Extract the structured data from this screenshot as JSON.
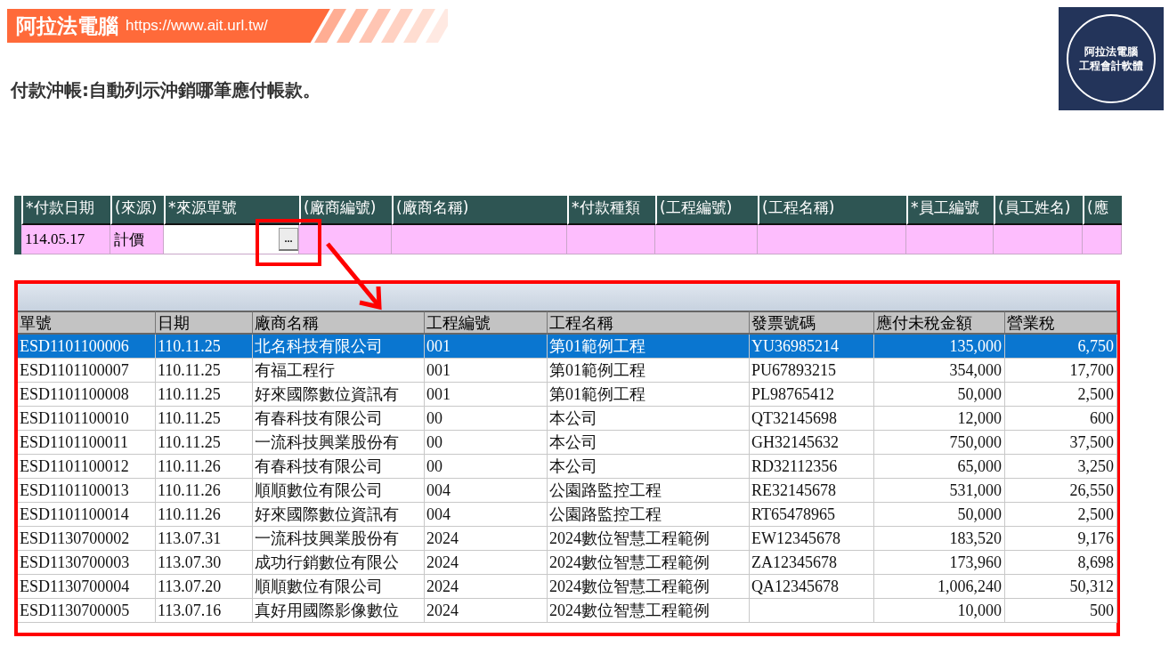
{
  "banner": {
    "brand": "阿拉法電腦",
    "url": "https://www.ait.url.tw/"
  },
  "subtitle": "付款沖帳:自動列示沖銷哪筆應付帳款。",
  "logo": {
    "lines": [
      "阿拉法電腦",
      "工程會計軟體"
    ]
  },
  "form": {
    "columns": [
      "*付款日期",
      "(來源)",
      "*來源單號",
      "(廠商編號)",
      "(廠商名稱)",
      "*付款種類",
      "(工程編號)",
      "(工程名稱)",
      "*員工編號",
      "(員工姓名)",
      "(應"
    ],
    "cells": [
      {
        "kind": "text",
        "value": "114.05.17"
      },
      {
        "kind": "text",
        "value": "計價"
      },
      {
        "kind": "lookup",
        "button": "..."
      },
      {
        "kind": "empty"
      },
      {
        "kind": "empty"
      },
      {
        "kind": "empty"
      },
      {
        "kind": "empty"
      },
      {
        "kind": "empty"
      },
      {
        "kind": "empty"
      },
      {
        "kind": "empty"
      },
      {
        "kind": "empty"
      }
    ]
  },
  "popup": {
    "columns": [
      {
        "label": "單號",
        "kind": "text"
      },
      {
        "label": "日期",
        "kind": "text"
      },
      {
        "label": "廠商名稱",
        "kind": "text"
      },
      {
        "label": "工程編號",
        "kind": "text"
      },
      {
        "label": "工程名稱",
        "kind": "text"
      },
      {
        "label": "發票號碼",
        "kind": "text"
      },
      {
        "label": "應付未稅金額",
        "kind": "number"
      },
      {
        "label": "營業稅",
        "kind": "number"
      }
    ],
    "rows": [
      {
        "selected": true,
        "cells": [
          "ESD1101100006",
          "110.11.25",
          "北名科技有限公司",
          "001",
          "第01範例工程",
          "YU36985214",
          "135,000",
          "6,750"
        ]
      },
      {
        "selected": false,
        "cells": [
          "ESD1101100007",
          "110.11.25",
          "有福工程行",
          "001",
          "第01範例工程",
          "PU67893215",
          "354,000",
          "17,700"
        ]
      },
      {
        "selected": false,
        "cells": [
          "ESD1101100008",
          "110.11.25",
          "好來國際數位資訊有",
          "001",
          "第01範例工程",
          "PL98765412",
          "50,000",
          "2,500"
        ]
      },
      {
        "selected": false,
        "cells": [
          "ESD1101100010",
          "110.11.25",
          "有春科技有限公司",
          "00",
          "本公司",
          "QT32145698",
          "12,000",
          "600"
        ]
      },
      {
        "selected": false,
        "cells": [
          "ESD1101100011",
          "110.11.25",
          "一流科技興業股份有",
          "00",
          "本公司",
          "GH32145632",
          "750,000",
          "37,500"
        ]
      },
      {
        "selected": false,
        "cells": [
          "ESD1101100012",
          "110.11.26",
          "有春科技有限公司",
          "00",
          "本公司",
          "RD32112356",
          "65,000",
          "3,250"
        ]
      },
      {
        "selected": false,
        "cells": [
          "ESD1101100013",
          "110.11.26",
          "順順數位有限公司",
          "004",
          "公園路監控工程",
          "RE32145678",
          "531,000",
          "26,550"
        ]
      },
      {
        "selected": false,
        "cells": [
          "ESD1101100014",
          "110.11.26",
          "好來國際數位資訊有",
          "004",
          "公園路監控工程",
          "RT65478965",
          "50,000",
          "2,500"
        ]
      },
      {
        "selected": false,
        "cells": [
          "ESD1130700002",
          "113.07.31",
          "一流科技興業股份有",
          "2024",
          "2024數位智慧工程範例",
          "EW12345678",
          "183,520",
          "9,176"
        ]
      },
      {
        "selected": false,
        "cells": [
          "ESD1130700003",
          "113.07.30",
          "成功行銷數位有限公",
          "2024",
          "2024數位智慧工程範例",
          "ZA12345678",
          "173,960",
          "8,698"
        ]
      },
      {
        "selected": false,
        "cells": [
          "ESD1130700004",
          "113.07.20",
          "順順數位有限公司",
          "2024",
          "2024數位智慧工程範例",
          "QA12345678",
          "1,006,240",
          "50,312"
        ]
      },
      {
        "selected": false,
        "cells": [
          "ESD1130700005",
          "113.07.16",
          "真好用國際影像數位",
          "2024",
          "2024數位智慧工程範例",
          "",
          "10,000",
          "500"
        ]
      }
    ]
  }
}
